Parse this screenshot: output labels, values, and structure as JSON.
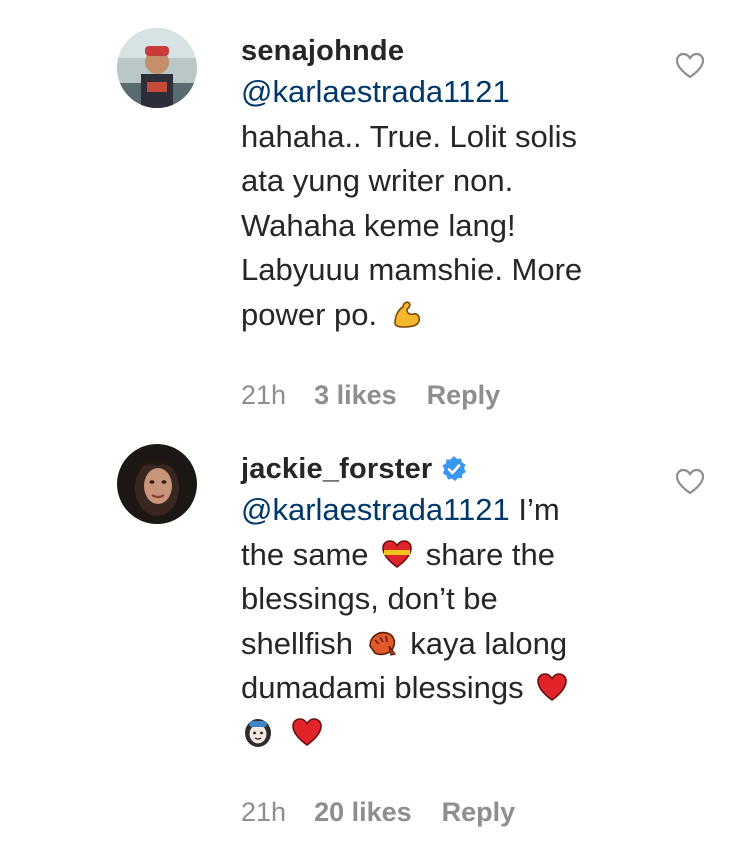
{
  "comments": [
    {
      "username": "senajohnde",
      "mention": "@karlaestrada1121",
      "lines": [
        "hahaha.. True. Lolit solis",
        "ata yung writer non.",
        "Wahaha keme lang!",
        "Labyuuu mamshie. More",
        "power po."
      ],
      "time": "21h",
      "likes": "3 likes",
      "reply": "Reply",
      "verified": false
    },
    {
      "username": "jackie_forster",
      "mention": "@karlaestrada1121",
      "mention_suffix": " I’m",
      "lines": [
        "the same",
        "share the",
        "blessings, don’t be",
        "shellfish",
        "kaya lalong",
        "dumadami blessings"
      ],
      "time": "21h",
      "likes": "20 likes",
      "reply": "Reply",
      "verified": true
    }
  ],
  "icons": {
    "like": "heart-outline-icon",
    "verified": "verified-badge-icon",
    "flexed_biceps": "flexed-biceps-emoji",
    "heart": "red-heart-emoji",
    "shrimp": "fried-shrimp-emoji",
    "person": "woman-emoji"
  },
  "colors": {
    "text": "#262626",
    "mention": "#00376b",
    "meta": "#8e8e8e",
    "verified": "#3897f0"
  }
}
